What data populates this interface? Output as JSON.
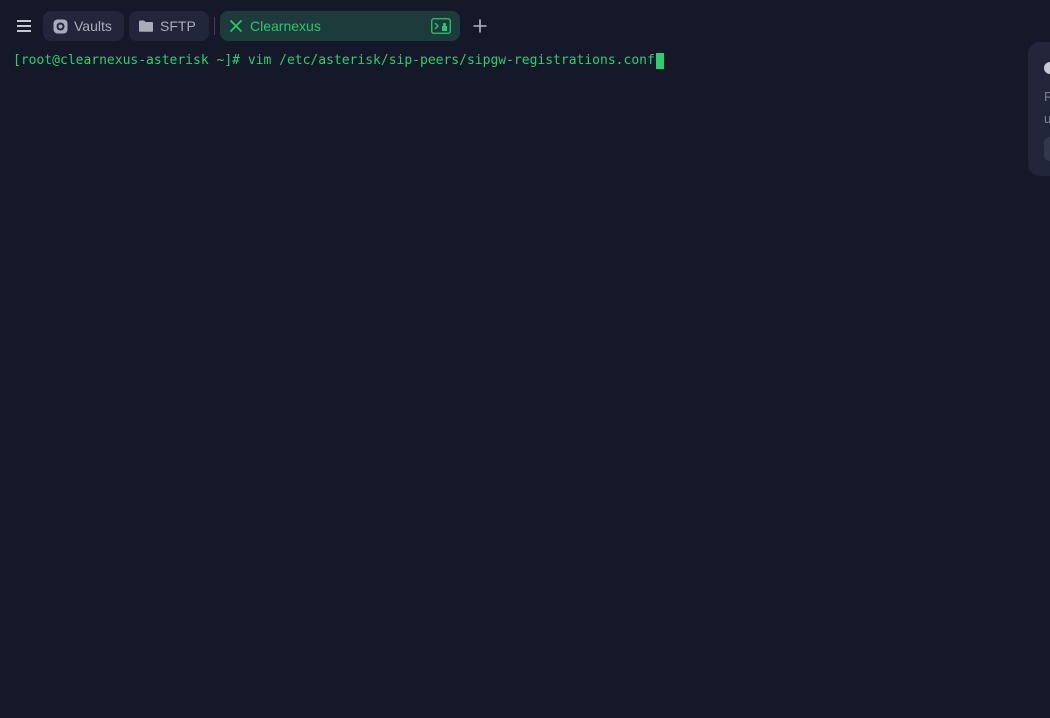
{
  "tabs": {
    "menu_icon": "hamburger-menu-icon",
    "vaults": {
      "label": "Vaults",
      "icon": "vault-icon"
    },
    "sftp": {
      "label": "SFTP",
      "icon": "folder-icon"
    },
    "active": {
      "label": "Clearnexus",
      "icon": "close-x-icon",
      "right_icon": "terminal-icon"
    },
    "new_tab_icon": "plus-icon"
  },
  "terminal": {
    "prompt": "[root@clearnexus-asterisk ~]# ",
    "command": "vim /etc/asterisk/sip-peers/sipgw-registrations.conf"
  },
  "notification": {
    "text_line1": "R",
    "text_line2": "u"
  },
  "colors": {
    "background": "#151829",
    "accent": "#27c86a",
    "tab_bg": "#22263a",
    "active_tab_bg": "#1d3b3a"
  }
}
